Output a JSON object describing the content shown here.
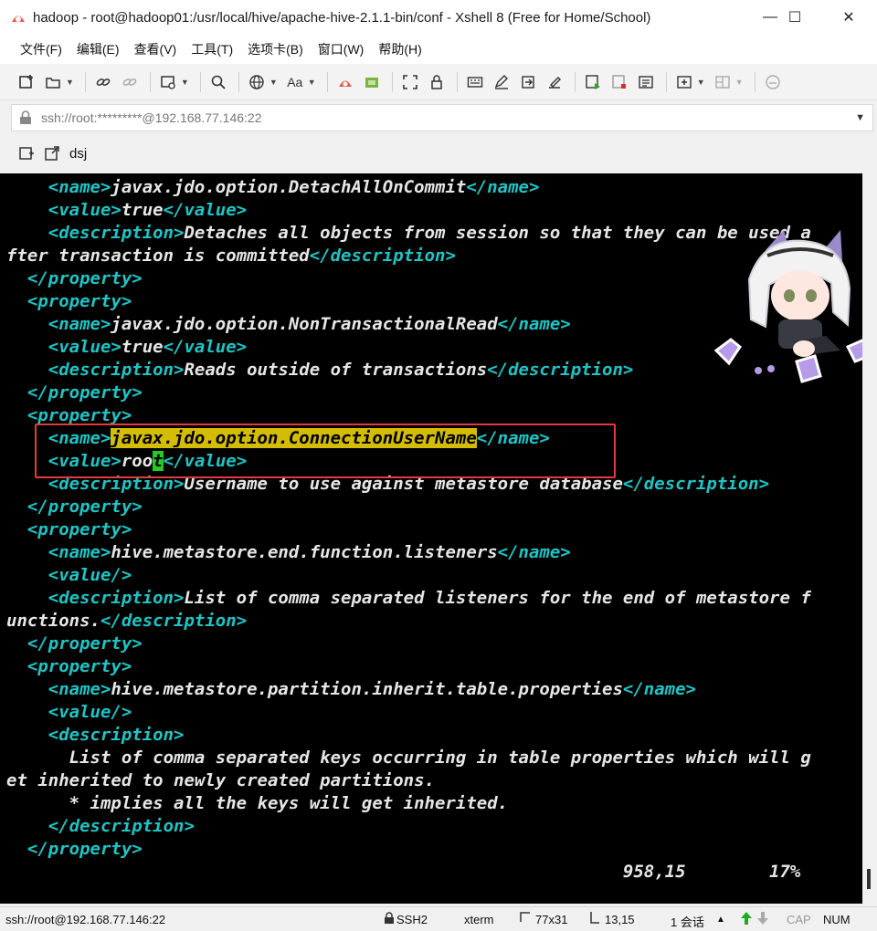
{
  "window": {
    "title": "hadoop - root@hadoop01:/usr/local/hive/apache-hive-2.1.1-bin/conf - Xshell 8 (Free for Home/School)",
    "controls": {
      "minimize": "—",
      "maximize": "☐",
      "close": "✕"
    }
  },
  "menu": [
    "文件(F)",
    "编辑(E)",
    "查看(V)",
    "工具(T)",
    "选项卡(B)",
    "窗口(W)",
    "帮助(H)"
  ],
  "address": {
    "text": "ssh://root:*********@192.168.77.146:22",
    "dropdown_icon": "▼"
  },
  "tabs": {
    "label": "dsj"
  },
  "terminal": {
    "lines": [
      [
        {
          "c": "tag",
          "t": "    <name>"
        },
        {
          "c": "txt",
          "t": "javax.jdo.option.DetachAllOnCommit"
        },
        {
          "c": "tag",
          "t": "</name>"
        }
      ],
      [
        {
          "c": "tag",
          "t": "    <value>"
        },
        {
          "c": "txt",
          "t": "true"
        },
        {
          "c": "tag",
          "t": "</value>"
        }
      ],
      [
        {
          "c": "tag",
          "t": "    <description>"
        },
        {
          "c": "txt",
          "t": "Detaches all objects from session so that they can be used a"
        }
      ],
      [
        {
          "c": "txt",
          "t": "fter transaction is committed"
        },
        {
          "c": "tag",
          "t": "</description>"
        }
      ],
      [
        {
          "c": "tag",
          "t": "  </property>"
        }
      ],
      [
        {
          "c": "tag",
          "t": "  <property>"
        }
      ],
      [
        {
          "c": "tag",
          "t": "    <name>"
        },
        {
          "c": "txt",
          "t": "javax.jdo.option.NonTransactionalRead"
        },
        {
          "c": "tag",
          "t": "</name>"
        }
      ],
      [
        {
          "c": "tag",
          "t": "    <value>"
        },
        {
          "c": "txt",
          "t": "true"
        },
        {
          "c": "tag",
          "t": "</value>"
        }
      ],
      [
        {
          "c": "tag",
          "t": "    <description>"
        },
        {
          "c": "txt",
          "t": "Reads outside of transactions"
        },
        {
          "c": "tag",
          "t": "</description>"
        }
      ],
      [
        {
          "c": "tag",
          "t": "  </property>"
        }
      ],
      [
        {
          "c": "tag",
          "t": "  <property>"
        }
      ],
      [
        {
          "c": "tag",
          "t": "    <name>"
        },
        {
          "c": "hl",
          "t": "javax.jdo.option.ConnectionUserName"
        },
        {
          "c": "tag",
          "t": "</name>"
        }
      ],
      [
        {
          "c": "tag",
          "t": "    <value>"
        },
        {
          "c": "txt",
          "t": "roo"
        },
        {
          "c": "cursor",
          "t": "t"
        },
        {
          "c": "tag",
          "t": "</value>"
        }
      ],
      [
        {
          "c": "tag",
          "t": "    <description>"
        },
        {
          "c": "txt",
          "t": "Username to use against metastore database"
        },
        {
          "c": "tag",
          "t": "</description>"
        }
      ],
      [
        {
          "c": "tag",
          "t": "  </property>"
        }
      ],
      [
        {
          "c": "tag",
          "t": "  <property>"
        }
      ],
      [
        {
          "c": "tag",
          "t": "    <name>"
        },
        {
          "c": "txt",
          "t": "hive.metastore.end.function.listeners"
        },
        {
          "c": "tag",
          "t": "</name>"
        }
      ],
      [
        {
          "c": "tag",
          "t": "    <value/>"
        }
      ],
      [
        {
          "c": "tag",
          "t": "    <description>"
        },
        {
          "c": "txt",
          "t": "List of comma separated listeners for the end of metastore f"
        }
      ],
      [
        {
          "c": "txt",
          "t": "unctions."
        },
        {
          "c": "tag",
          "t": "</description>"
        }
      ],
      [
        {
          "c": "tag",
          "t": "  </property>"
        }
      ],
      [
        {
          "c": "tag",
          "t": "  <property>"
        }
      ],
      [
        {
          "c": "tag",
          "t": "    <name>"
        },
        {
          "c": "txt",
          "t": "hive.metastore.partition.inherit.table.properties"
        },
        {
          "c": "tag",
          "t": "</name>"
        }
      ],
      [
        {
          "c": "tag",
          "t": "    <value/>"
        }
      ],
      [
        {
          "c": "tag",
          "t": "    <description>"
        }
      ],
      [
        {
          "c": "txt",
          "t": "      List of comma separated keys occurring in table properties which will g"
        }
      ],
      [
        {
          "c": "txt",
          "t": "et inherited to newly created partitions."
        }
      ],
      [
        {
          "c": "txt",
          "t": "      * implies all the keys will get inherited."
        }
      ],
      [
        {
          "c": "tag",
          "t": "    </description>"
        }
      ],
      [
        {
          "c": "tag",
          "t": "  </property>"
        }
      ],
      [
        {
          "c": "status-pos",
          "t": "                                                           958,15        17%"
        }
      ]
    ],
    "colors": {
      "background": "#000000",
      "tag": "#1fc4c4",
      "text": "#e6e6e6",
      "highlight": "#d4bd00",
      "cursor": "#22cc22"
    }
  },
  "statusbar": {
    "address": "ssh://root@192.168.77.146:22",
    "protocol": "SSH2",
    "term": "xterm",
    "size": "77x31",
    "cursor_pos": "13,15",
    "sessions": "1 会话",
    "cap": "CAP",
    "num": "NUM"
  },
  "annotation": {
    "box_color": "#e23b3b"
  }
}
